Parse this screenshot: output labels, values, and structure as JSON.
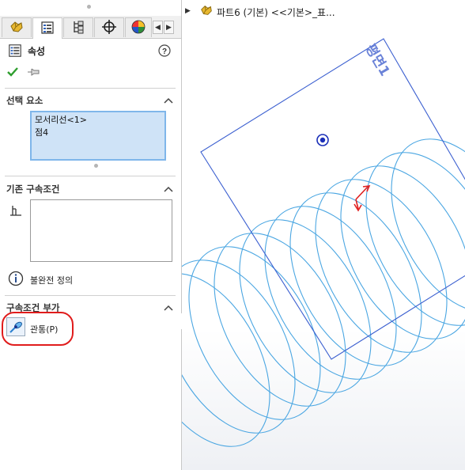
{
  "property_manager": {
    "title": "속성",
    "tabs": [
      {
        "name": "featuremanager-tab",
        "active": false
      },
      {
        "name": "propertymanager-tab",
        "active": true
      },
      {
        "name": "configurationmanager-tab",
        "active": false
      },
      {
        "name": "dimxpert-tab",
        "active": false
      },
      {
        "name": "display-manager-tab",
        "active": false
      }
    ],
    "confirm_icon": "checkmark-icon",
    "pin_icon": "pushpin-icon",
    "help_icon": "question-mark-icon"
  },
  "selected_entities": {
    "heading": "선택 요소",
    "items": [
      "모서리선<1>",
      "점4"
    ]
  },
  "existing_relations": {
    "heading": "기존 구속조건",
    "items": [],
    "status": "불완전 정의"
  },
  "add_relations": {
    "heading": "구속조건 부가",
    "pierce_label": "관통(P)"
  },
  "tree": {
    "part_label": "파트6 (기본) <<기본>_표..."
  },
  "viewport": {
    "plane_label": "평면1",
    "plane_color": "#3b5fd0",
    "helix_color": "#4aa6e2",
    "point_color": "#1a2fb8",
    "triad_color": "#e02020",
    "highlight_color": "#e01c1c"
  }
}
